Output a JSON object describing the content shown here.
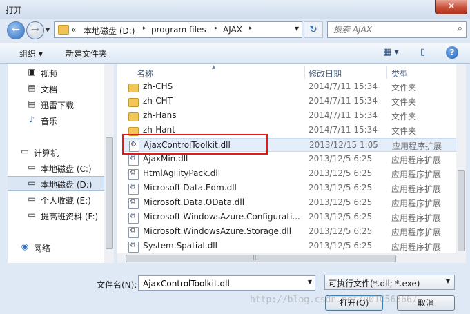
{
  "window": {
    "title": "打开",
    "close_label": "✕"
  },
  "nav": {
    "back_icon": "←",
    "forward_icon": "→",
    "dropdown_icon": "▼"
  },
  "address": {
    "prefix": "«",
    "crumbs": [
      "本地磁盘 (D:)",
      "program files",
      "AJAX"
    ],
    "separator": "▸",
    "dropdown_icon": "▼"
  },
  "refresh_icon": "↻",
  "search": {
    "placeholder": "搜索 AJAX",
    "icon": "⌕"
  },
  "toolbar": {
    "organize_label": "组织 ▾",
    "new_folder_label": "新建文件夹",
    "view_icon": "▦ ▾",
    "pane_icon": "▯",
    "help_label": "?"
  },
  "sidebar": {
    "items": [
      {
        "label": "视频",
        "icon": "▣",
        "selected": false
      },
      {
        "label": "文档",
        "icon": "▤",
        "selected": false
      },
      {
        "label": "迅雷下载",
        "icon": "▤",
        "selected": false
      },
      {
        "label": "音乐",
        "icon": "♪",
        "selected": false
      },
      {
        "label": "计算机",
        "icon": "▭",
        "selected": false
      },
      {
        "label": "本地磁盘 (C:)",
        "icon": "▭",
        "selected": false
      },
      {
        "label": "本地磁盘 (D:)",
        "icon": "▭",
        "selected": true
      },
      {
        "label": "个人收藏 (E:)",
        "icon": "▭",
        "selected": false
      },
      {
        "label": "提高班资料 (F:)",
        "icon": "▭",
        "selected": false
      },
      {
        "label": "网络",
        "icon": "◉",
        "selected": false
      }
    ]
  },
  "columns": {
    "name": "名称",
    "date": "修改日期",
    "type": "类型"
  },
  "files": [
    {
      "name": "zh-CHS",
      "date": "2014/7/11 15:34",
      "type": "文件夹",
      "kind": "folder"
    },
    {
      "name": "zh-CHT",
      "date": "2014/7/11 15:34",
      "type": "文件夹",
      "kind": "folder"
    },
    {
      "name": "zh-Hans",
      "date": "2014/7/11 15:34",
      "type": "文件夹",
      "kind": "folder"
    },
    {
      "name": "zh-Hant",
      "date": "2014/7/11 15:34",
      "type": "文件夹",
      "kind": "folder"
    },
    {
      "name": "AjaxControlToolkit.dll",
      "date": "2013/12/15 1:05",
      "type": "应用程序扩展",
      "kind": "dll",
      "selected": true
    },
    {
      "name": "AjaxMin.dll",
      "date": "2013/12/5 6:25",
      "type": "应用程序扩展",
      "kind": "dll"
    },
    {
      "name": "HtmlAgilityPack.dll",
      "date": "2013/12/5 6:25",
      "type": "应用程序扩展",
      "kind": "dll"
    },
    {
      "name": "Microsoft.Data.Edm.dll",
      "date": "2013/12/5 6:25",
      "type": "应用程序扩展",
      "kind": "dll"
    },
    {
      "name": "Microsoft.Data.OData.dll",
      "date": "2013/12/5 6:25",
      "type": "应用程序扩展",
      "kind": "dll"
    },
    {
      "name": "Microsoft.WindowsAzure.Configurati...",
      "date": "2013/12/5 6:25",
      "type": "应用程序扩展",
      "kind": "dll"
    },
    {
      "name": "Microsoft.WindowsAzure.Storage.dll",
      "date": "2013/12/5 6:25",
      "type": "应用程序扩展",
      "kind": "dll"
    },
    {
      "name": "System.Spatial.dll",
      "date": "2013/12/5 6:25",
      "type": "应用程序扩展",
      "kind": "dll"
    }
  ],
  "bottom": {
    "filename_label": "文件名(N):",
    "filename_value": "AjaxControlToolkit.dll",
    "filetype_value": "可执行文件(*.dll; *.exe)",
    "open_label": "打开(O)",
    "cancel_label": "取消"
  },
  "watermark": "http://blog.csdn.net/u010563667",
  "colors": {
    "highlight": "#e11a1a",
    "selection": "#e4eefb"
  }
}
